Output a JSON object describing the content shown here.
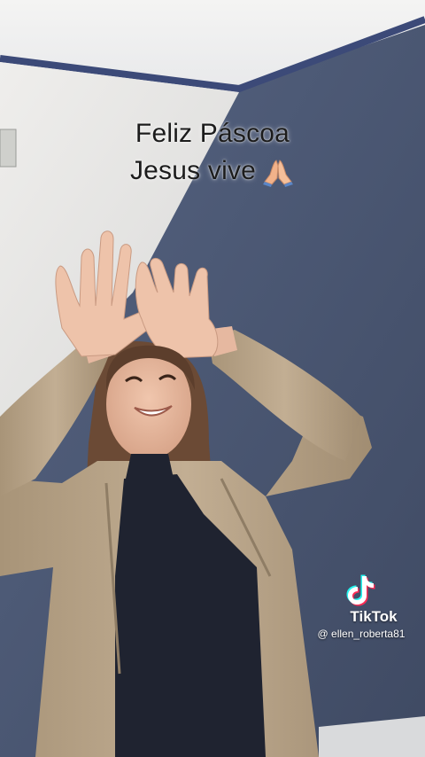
{
  "video": {
    "caption_line1": "Feliz Páscoa",
    "caption_line2": "Jesus vive",
    "caption_emoji": "praying-hands-icon"
  },
  "watermark": {
    "brand": "TikTok",
    "handle": "@ ellen_roberta81",
    "icon": "tiktok-logo-icon"
  },
  "colors": {
    "caption_text": "#1c1c1c",
    "wall_blue": "#4d5a77",
    "wall_white": "#ecebe8",
    "jacket": "#b9a58a",
    "shirt": "#1e2230",
    "tiktok_cyan": "#25f4ee",
    "tiktok_pink": "#fe2c55"
  }
}
